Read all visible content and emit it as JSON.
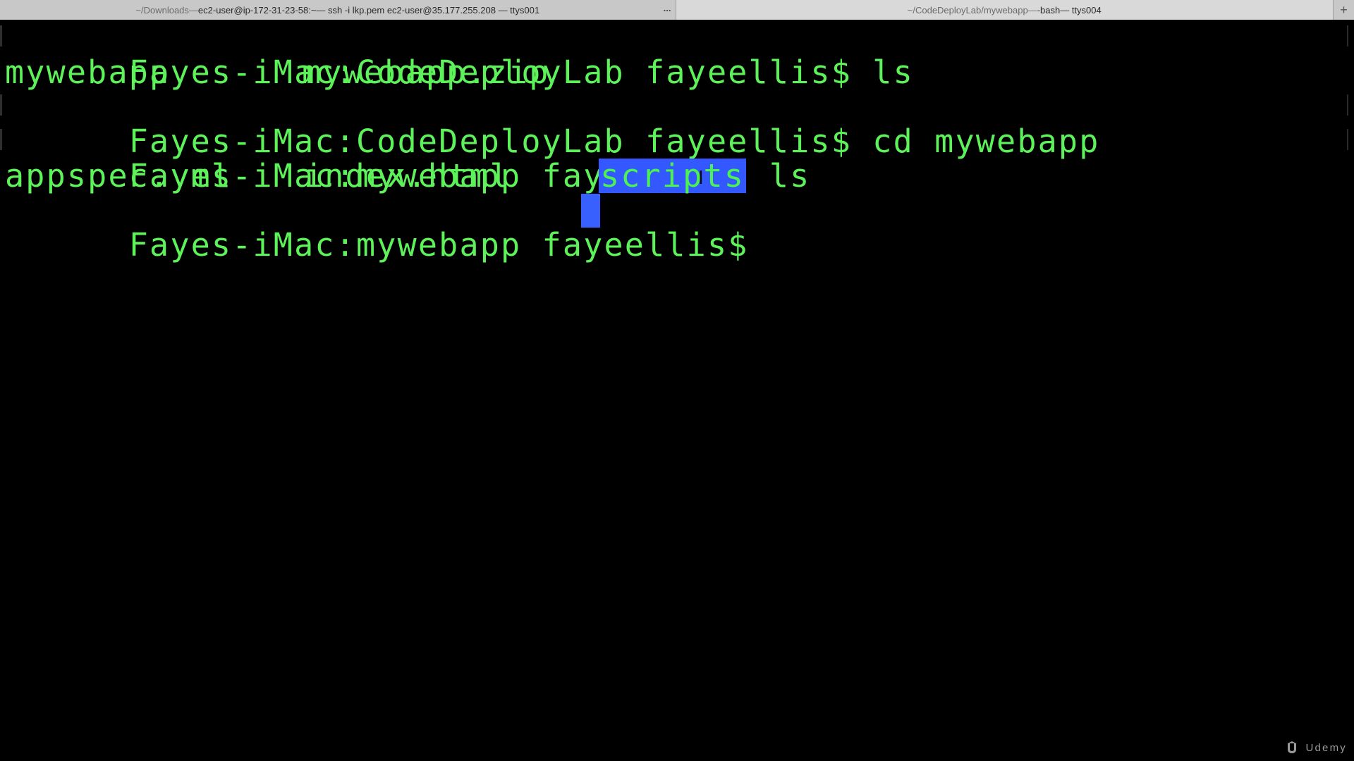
{
  "tabs": [
    {
      "path": "~/Downloads",
      "sep1": " — ",
      "host": "ec2-user@ip-172-31-23-58:~",
      "rest": " — ssh -i lkp.pem ec2-user@35.177.255.208 — ttys001",
      "overflow": "..."
    },
    {
      "path": "~/CodeDeployLab/mywebapp",
      "sep1": " — ",
      "host": "-bash",
      "rest": " — ttys004"
    }
  ],
  "new_tab_label": "+",
  "terminal": {
    "lines": [
      {
        "prompt": "Fayes-iMac:CodeDeployLab fayeellis$",
        "command": " ls"
      },
      {
        "output_a": "mywebapp",
        "output_b": "mywebapp.zip"
      },
      {
        "prompt": "Fayes-iMac:CodeDeployLab fayeellis$",
        "command": " cd mywebapp"
      },
      {
        "prompt": "Fayes-iMac:mywebapp fayeellis$",
        "command": " ls"
      },
      {
        "output_a": "appspec.yml",
        "output_b": "index.html",
        "output_c": "scripts"
      },
      {
        "prompt": "Fayes-iMac:mywebapp fayeellis$",
        "command": " "
      }
    ],
    "text_color": "#5df25a",
    "selection_color": "#3358ff",
    "background": "#000000"
  },
  "watermark": "Udemy"
}
